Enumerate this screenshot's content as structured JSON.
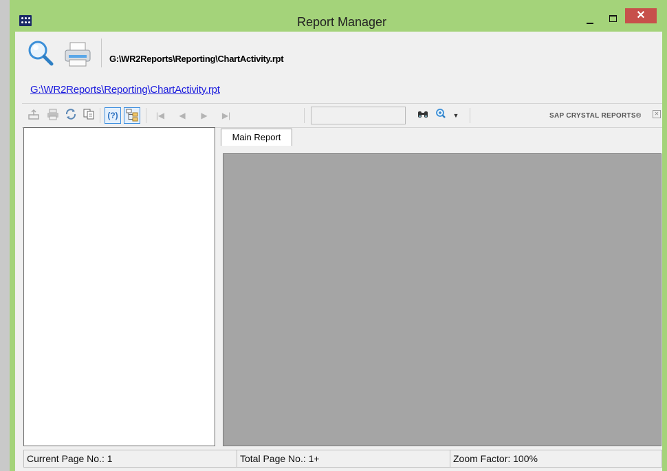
{
  "window": {
    "title": "Report Manager",
    "controls": {
      "minimize": "–",
      "maximize": "□",
      "close": "✕"
    }
  },
  "top_toolbar": {
    "buttons": [
      {
        "icon": "magnifier-icon",
        "label": ""
      },
      {
        "icon": "printer-icon",
        "label": ""
      }
    ],
    "report_path": "G:\\WR2Reports\\Reporting\\ChartActivity.rpt"
  },
  "report_link": "G:\\WR2Reports\\Reporting\\ChartActivity.rpt",
  "viewer_toolbar": {
    "icons": [
      "export-icon",
      "print-icon",
      "refresh-icon",
      "copy-icon",
      "help-icon",
      "group-tree-icon",
      "first-page-icon",
      "previous-page-icon",
      "next-page-icon",
      "last-page-icon",
      "find-icon",
      "zoom-icon"
    ],
    "page_input_value": "",
    "brand": "SAP CRYSTAL REPORTS®"
  },
  "tabs": [
    {
      "label": "Main Report",
      "selected": true
    }
  ],
  "status_bar": {
    "current_page": "Current Page No.: 1",
    "total_pages": "Total Page No.: 1+",
    "zoom": "Zoom Factor: 100%"
  },
  "colors": {
    "window_frame": "#a4d37a",
    "close_button": "#c7504b",
    "preview_background": "#a5a5a5",
    "link": "#1a1add"
  }
}
